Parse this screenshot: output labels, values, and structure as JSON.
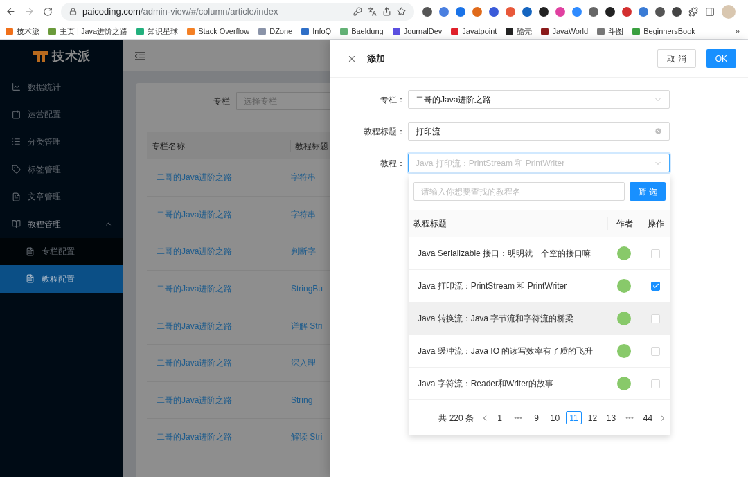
{
  "browser": {
    "url_host": "paicoding.com",
    "url_path": "/admin-view/#/column/article/index",
    "more": "»",
    "bookmarks": [
      {
        "label": "技术派",
        "color": "#f0701a"
      },
      {
        "label": "主页 | Java进阶之路",
        "color": "#6a9a3a"
      },
      {
        "label": "知识星球",
        "color": "#22b07d"
      },
      {
        "label": "Stack Overflow",
        "color": "#f48024"
      },
      {
        "label": "DZone",
        "color": "#8a93a8"
      },
      {
        "label": "InfoQ",
        "color": "#2f6fc7"
      },
      {
        "label": "Baeldung",
        "color": "#63b175"
      },
      {
        "label": "JournalDev",
        "color": "#5b4fe0"
      },
      {
        "label": "Javatpoint",
        "color": "#e0202a"
      },
      {
        "label": "酷壳",
        "color": "#222222"
      },
      {
        "label": "JavaWorld",
        "color": "#8b1a1a"
      },
      {
        "label": "斗图",
        "color": "#777777"
      },
      {
        "label": "BeginnersBook",
        "color": "#3aa040"
      }
    ]
  },
  "sidebar": {
    "logo": "技术派",
    "items": [
      {
        "label": "数据统计",
        "kind": "chart",
        "selected": false
      },
      {
        "label": "运营配置",
        "kind": "calendar",
        "selected": false
      },
      {
        "label": "分类管理",
        "kind": "list",
        "selected": false
      },
      {
        "label": "标签管理",
        "kind": "tag",
        "selected": false
      },
      {
        "label": "文章管理",
        "kind": "file",
        "selected": false
      },
      {
        "label": "教程管理",
        "kind": "book",
        "selected": false,
        "expanded": true,
        "children": [
          {
            "label": "专栏配置",
            "kind": "file",
            "selected": false
          },
          {
            "label": "教程配置",
            "kind": "file",
            "selected": true
          }
        ]
      }
    ]
  },
  "page": {
    "filter_label": "专栏",
    "filter_placeholder": "选择专栏",
    "columns": [
      "专栏名称",
      "教程标题"
    ],
    "rows": [
      [
        "二哥的Java进阶之路",
        "字符串"
      ],
      [
        "二哥的Java进阶之路",
        "字符串"
      ],
      [
        "二哥的Java进阶之路",
        "判断字"
      ],
      [
        "二哥的Java进阶之路",
        "StringBu"
      ],
      [
        "二哥的Java进阶之路",
        "详解 Stri"
      ],
      [
        "二哥的Java进阶之路",
        "深入理"
      ],
      [
        "二哥的Java进阶之路",
        "String"
      ],
      [
        "二哥的Java进阶之路",
        "解读 Stri"
      ]
    ]
  },
  "drawer": {
    "title": "添加",
    "cancel": "取 消",
    "ok": "OK",
    "fields": [
      {
        "kind": "select",
        "label": "专栏：",
        "value": "二哥的Java进阶之路",
        "focused": false
      },
      {
        "kind": "input",
        "label": "教程标题：",
        "value": "打印流",
        "focused": false
      },
      {
        "kind": "select",
        "label": "教程：",
        "placeholder": "Java 打印流：PrintStream 和 PrintWriter",
        "focused": true
      }
    ],
    "dropdown": {
      "search_placeholder": "请输入你想要查找的教程名",
      "search_button": "筛 选",
      "columns": [
        "教程标题",
        "作者",
        "操作"
      ],
      "rows": [
        {
          "title": "Java Serializable 接口：明明就一个空的接口嘛",
          "checked": false,
          "highlighted": false
        },
        {
          "title": "Java 打印流：PrintStream 和 PrintWriter",
          "checked": true,
          "highlighted": false
        },
        {
          "title": "Java 转换流：Java 字节流和字符流的桥梁",
          "checked": false,
          "highlighted": true
        },
        {
          "title": "Java 缓冲流：Java IO 的读写效率有了质的飞升",
          "checked": false,
          "highlighted": false
        },
        {
          "title": "Java 字符流：Reader和Writer的故事",
          "checked": false,
          "highlighted": false
        }
      ],
      "pagination": {
        "total": "共 220 条",
        "pages": [
          {
            "kind": "page",
            "label": "1",
            "selected": false
          },
          {
            "kind": "ellipsis",
            "label": "•••"
          },
          {
            "kind": "page",
            "label": "9",
            "selected": false
          },
          {
            "kind": "page",
            "label": "10",
            "selected": false
          },
          {
            "kind": "page",
            "label": "11",
            "selected": true
          },
          {
            "kind": "page",
            "label": "12",
            "selected": false
          },
          {
            "kind": "page",
            "label": "13",
            "selected": false
          },
          {
            "kind": "ellipsis",
            "label": "•••"
          },
          {
            "kind": "page",
            "label": "44",
            "selected": false
          }
        ]
      }
    }
  }
}
